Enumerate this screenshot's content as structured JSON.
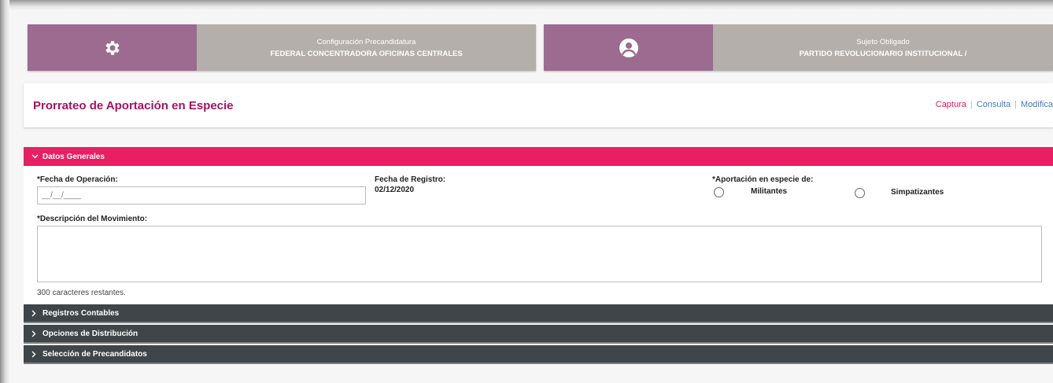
{
  "cards": {
    "config": {
      "title": "Configuración Precandidatura",
      "subtitle": "FEDERAL CONCENTRADORA OFICINAS CENTRALES",
      "icon": "gear-icon"
    },
    "subject": {
      "title": "Sujeto Obligado",
      "subtitle": "PARTIDO REVOLUCIONARIO INSTITUCIONAL /",
      "icon": "user-circle-icon"
    }
  },
  "page": {
    "title": "Prorrateo de Aportación en Especie",
    "links": {
      "captura": "Captura",
      "consulta": "Consulta",
      "modifica": "Modifica"
    }
  },
  "sections": {
    "datos_generales": "Datos Generales",
    "registros_contables": "Registros Contables",
    "opciones_distribucion": "Opciones de Distribución",
    "seleccion_precandidatos": "Selección de Precandidatos"
  },
  "form": {
    "fecha_operacion_label": "*Fecha de Operación:",
    "fecha_operacion_placeholder": "__/__/____",
    "fecha_registro_label": "Fecha de Registro:",
    "fecha_registro_value": "02/12/2020",
    "aportacion_label": "*Aportación en especie de:",
    "militantes": "Militantes",
    "simpatizantes": "Simpatizantes",
    "descripcion_label": "*Descripción del Movimiento:",
    "descripcion_value": "",
    "counter": "300 caracteres restantes."
  },
  "colors": {
    "accent_pink": "#e91e63",
    "title_magenta": "#a8125f",
    "card_purple": "#9c6b8f",
    "card_gray": "#b5afab",
    "section_dark": "#3f4548"
  }
}
